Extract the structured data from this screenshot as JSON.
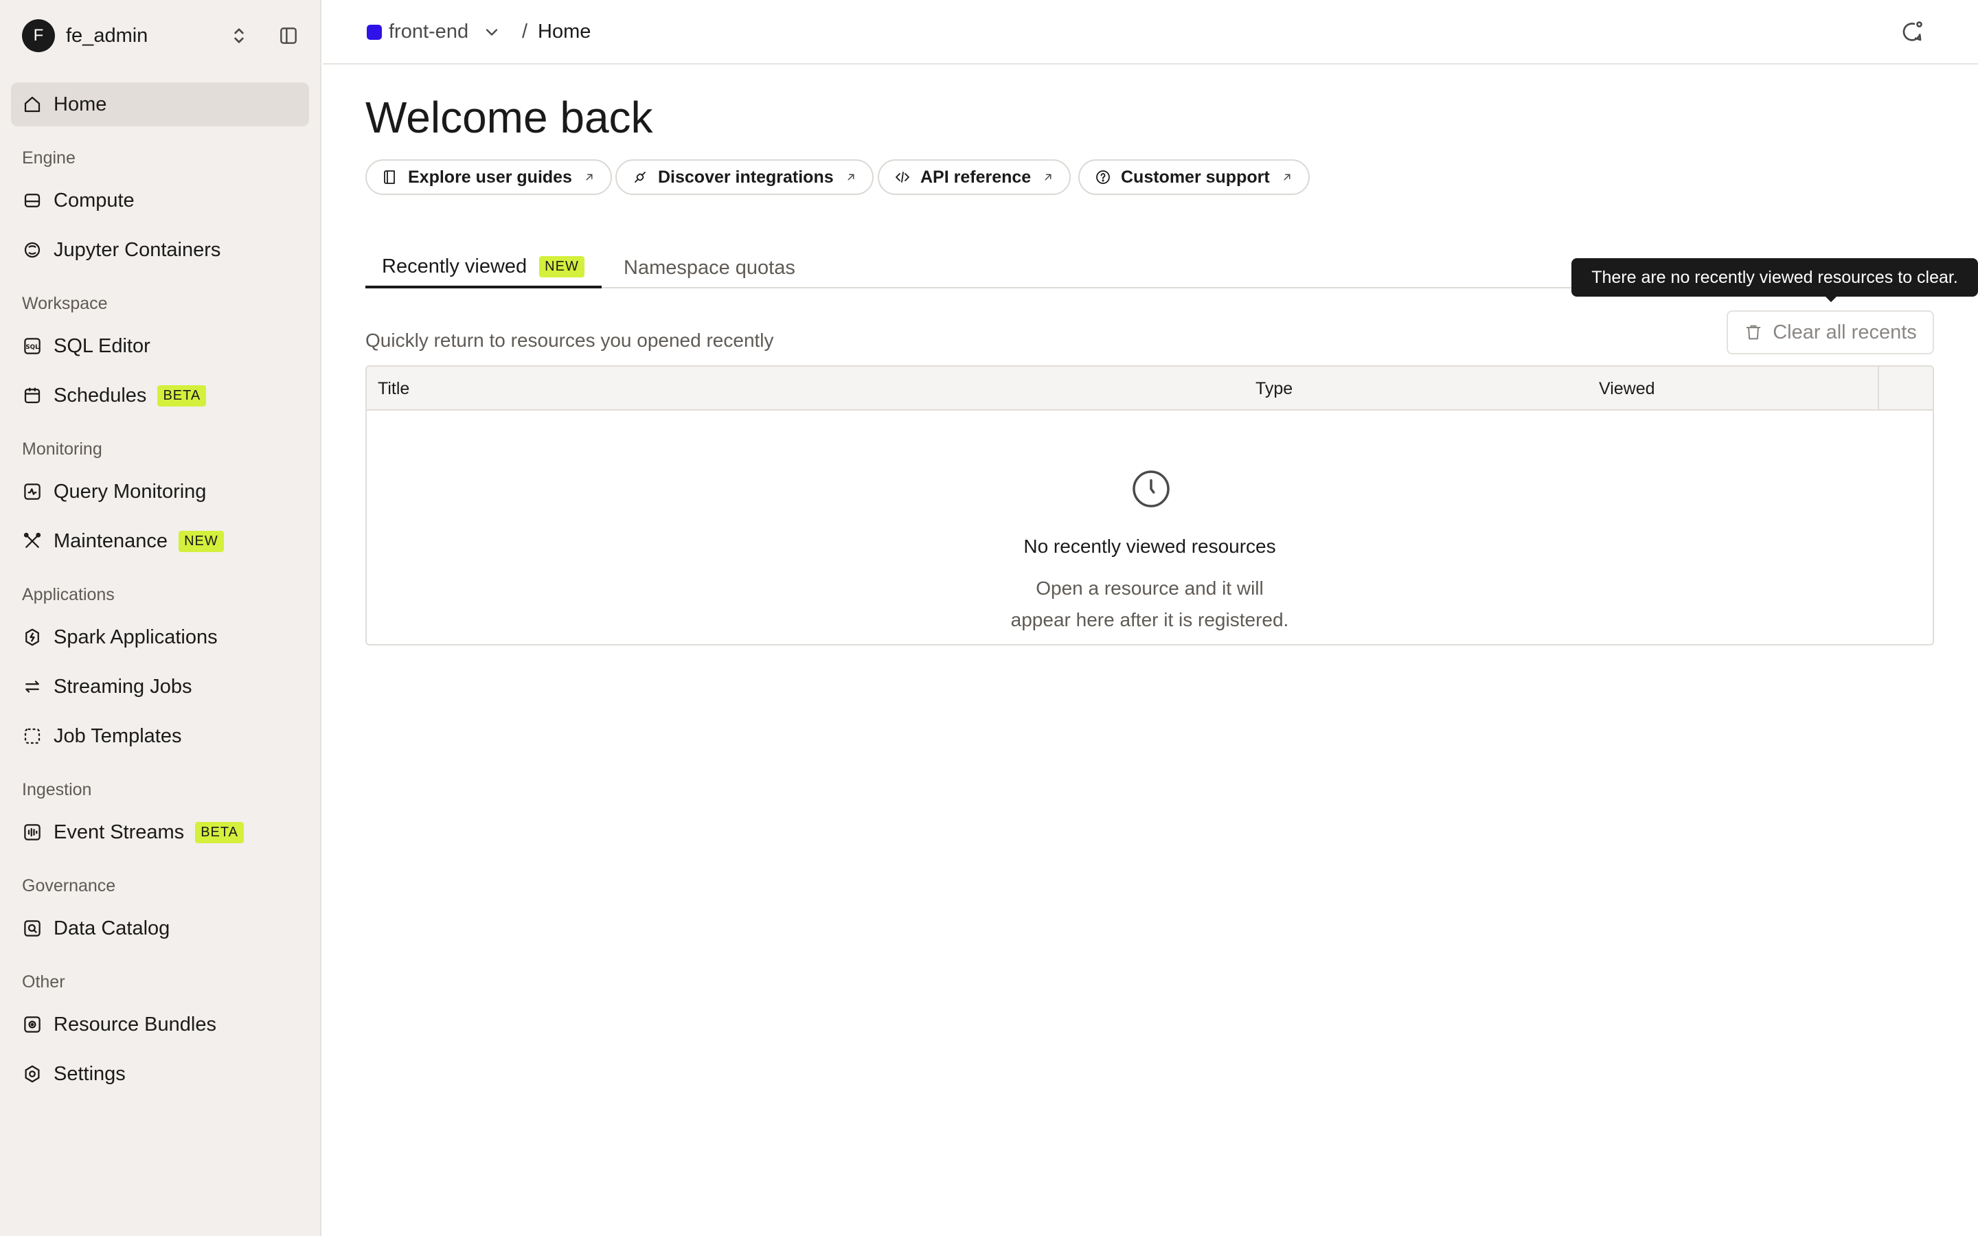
{
  "account": {
    "initial": "F",
    "name": "fe_admin"
  },
  "nav": {
    "home": "Home",
    "sections": {
      "engine": "Engine",
      "workspace": "Workspace",
      "monitoring": "Monitoring",
      "applications": "Applications",
      "ingestion": "Ingestion",
      "governance": "Governance",
      "other": "Other"
    },
    "items": {
      "compute": "Compute",
      "jupyter": "Jupyter Containers",
      "sql_editor": "SQL Editor",
      "schedules": "Schedules",
      "query_monitoring": "Query Monitoring",
      "maintenance": "Maintenance",
      "spark": "Spark Applications",
      "streaming": "Streaming Jobs",
      "job_templates": "Job Templates",
      "event_streams": "Event Streams",
      "data_catalog": "Data Catalog",
      "resource_bundles": "Resource Bundles",
      "settings": "Settings"
    },
    "badges": {
      "beta": "BETA",
      "new": "NEW"
    }
  },
  "topbar": {
    "namespace": "front-end",
    "separator": "/",
    "current": "Home"
  },
  "page": {
    "title": "Welcome back"
  },
  "quick_links": {
    "guides": "Explore user guides",
    "integrations": "Discover integrations",
    "api": "API reference",
    "support": "Customer support"
  },
  "tabs": {
    "recent": "Recently viewed",
    "recent_badge": "NEW",
    "quotas": "Namespace quotas"
  },
  "recent": {
    "subtitle": "Quickly return to resources you opened recently",
    "clear_label": "Clear all recents",
    "tooltip": "There are no recently viewed resources to clear.",
    "columns": {
      "title": "Title",
      "type": "Type",
      "viewed": "Viewed"
    },
    "empty_title": "No recently viewed resources",
    "empty_desc_1": "Open a resource and it will",
    "empty_desc_2": "appear here after it is registered."
  },
  "colors": {
    "accent_badge": "#d4f03c",
    "namespace": "#2f12e8",
    "sidebar_bg": "#f2efec"
  }
}
